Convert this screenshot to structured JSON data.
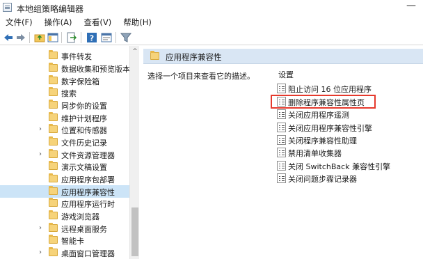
{
  "window": {
    "title": "本地组策略编辑器",
    "minimize_glyph": "—"
  },
  "menu": [
    "文件(F)",
    "操作(A)",
    "查看(V)",
    "帮助(H)"
  ],
  "toolbar": {
    "buttons": [
      "back-arrow-icon",
      "forward-arrow-icon",
      "up-folder-icon",
      "show-hide-tree-icon",
      "export-list-icon",
      "help-icon",
      "properties-icon",
      "filter-icon"
    ]
  },
  "tree": {
    "items": [
      {
        "label": "事件转发",
        "expandable": false,
        "selected": false
      },
      {
        "label": "数据收集和预览版本",
        "expandable": false,
        "selected": false
      },
      {
        "label": "数字保险箱",
        "expandable": false,
        "selected": false
      },
      {
        "label": "搜索",
        "expandable": false,
        "selected": false
      },
      {
        "label": "同步你的设置",
        "expandable": false,
        "selected": false
      },
      {
        "label": "维护计划程序",
        "expandable": false,
        "selected": false
      },
      {
        "label": "位置和传感器",
        "expandable": true,
        "selected": false
      },
      {
        "label": "文件历史记录",
        "expandable": false,
        "selected": false
      },
      {
        "label": "文件资源管理器",
        "expandable": true,
        "selected": false
      },
      {
        "label": "演示文稿设置",
        "expandable": false,
        "selected": false
      },
      {
        "label": "应用程序包部署",
        "expandable": false,
        "selected": false
      },
      {
        "label": "应用程序兼容性",
        "expandable": false,
        "selected": true
      },
      {
        "label": "应用程序运行时",
        "expandable": false,
        "selected": false
      },
      {
        "label": "游戏浏览器",
        "expandable": false,
        "selected": false
      },
      {
        "label": "远程桌面服务",
        "expandable": true,
        "selected": false
      },
      {
        "label": "智能卡",
        "expandable": false,
        "selected": false
      },
      {
        "label": "桌面窗口管理器",
        "expandable": true,
        "selected": false
      }
    ],
    "expand_glyph": "›",
    "scroll_up_glyph": "^"
  },
  "content": {
    "header_title": "应用程序兼容性",
    "description": "选择一个项目来查看它的描述。",
    "settings_heading": "设置",
    "policies": [
      "阻止访问 16 位应用程序",
      "删除程序兼容性属性页",
      "关闭应用程序遥测",
      "关闭应用程序兼容性引擎",
      "关闭程序兼容性助理",
      "禁用清单收集器",
      "关闭 SwitchBack 兼容性引擎",
      "关闭问题步骤记录器"
    ],
    "highlighted_policy": "删除程序兼容性属性页",
    "highlight_color": "#e5392c"
  }
}
